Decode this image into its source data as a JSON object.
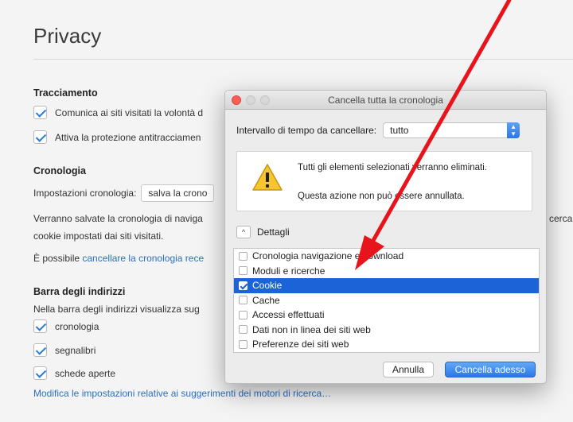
{
  "page": {
    "title": "Privacy",
    "tracking": {
      "heading": "Tracciamento",
      "items": [
        "Comunica ai siti visitati la volontà d",
        "Attiva la protezione antitracciamen"
      ]
    },
    "history": {
      "heading": "Cronologia",
      "settings_label": "Impostazioni cronologia:",
      "settings_value": "salva la crono",
      "description_line1": "Verranno salvate la cronologia di naviga",
      "description_line1_right": "cerca",
      "description_line2": "cookie impostati dai siti visitati.",
      "clear_prefix": "È possibile ",
      "clear_link": "cancellare la cronologia rece"
    },
    "address_bar": {
      "heading": "Barra degli indirizzi",
      "description": "Nella barra degli indirizzi visualizza sug",
      "items": [
        "cronologia",
        "segnalibri",
        "schede aperte"
      ],
      "settings_link": "Modifica le impostazioni relative ai suggerimenti dei motori di ricerca…"
    }
  },
  "dialog": {
    "title": "Cancella tutta la cronologia",
    "range_label": "Intervallo di tempo da cancellare:",
    "range_value": "tutto",
    "warning_line1": "Tutti gli elementi selezionati verranno eliminati.",
    "warning_line2": "Questa azione non può essere annullata.",
    "details_label": "Dettagli",
    "items": [
      {
        "label": "Cronologia navigazione e download",
        "checked": false
      },
      {
        "label": "Moduli e ricerche",
        "checked": false
      },
      {
        "label": "Cookie",
        "checked": true
      },
      {
        "label": "Cache",
        "checked": false
      },
      {
        "label": "Accessi effettuati",
        "checked": false
      },
      {
        "label": "Dati non in linea dei siti web",
        "checked": false
      },
      {
        "label": "Preferenze dei siti web",
        "checked": false
      }
    ],
    "cancel_label": "Annulla",
    "confirm_label": "Cancella adesso"
  },
  "colors": {
    "accent": "#1b63d6",
    "link": "#2b6fc2",
    "annotation_arrow": "#e8141c"
  }
}
